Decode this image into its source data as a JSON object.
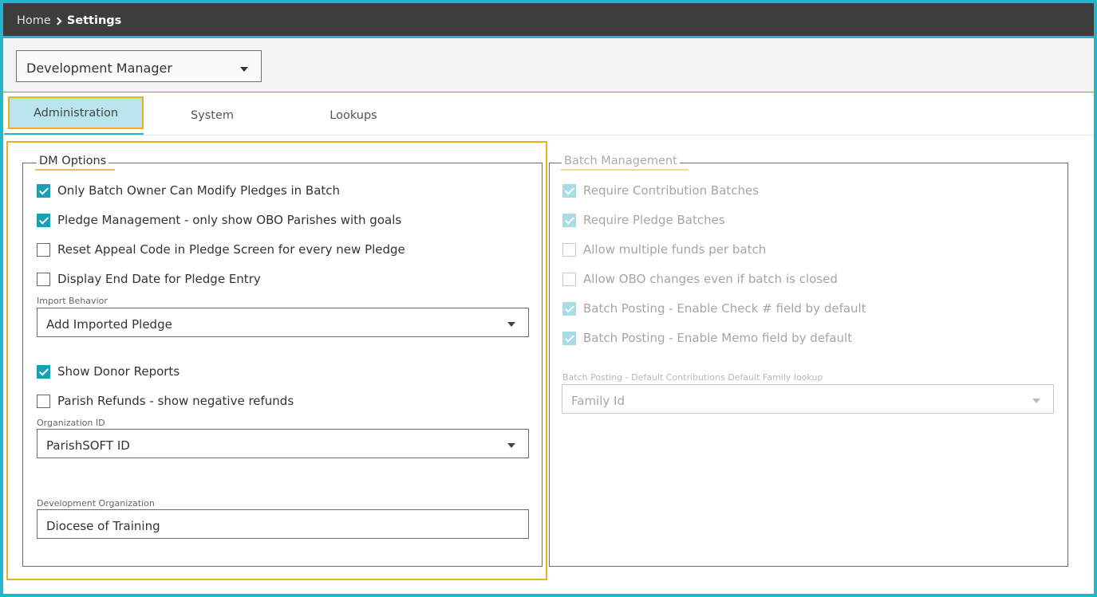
{
  "breadcrumb": {
    "home": "Home",
    "current": "Settings"
  },
  "module_select": {
    "value": "Development Manager"
  },
  "tabs": [
    {
      "label": "Administration",
      "active": true
    },
    {
      "label": "System",
      "active": false
    },
    {
      "label": "Lookups",
      "active": false
    }
  ],
  "dm_options": {
    "legend": "DM Options",
    "checks": [
      {
        "label": "Only Batch Owner Can Modify Pledges in Batch",
        "checked": true
      },
      {
        "label": "Pledge Management - only show OBO Parishes with goals",
        "checked": true
      },
      {
        "label": "Reset Appeal Code in Pledge Screen for every new Pledge",
        "checked": false
      },
      {
        "label": "Display End Date for Pledge Entry",
        "checked": false
      }
    ],
    "import_behavior": {
      "label": "Import Behavior",
      "value": "Add Imported Pledge"
    },
    "checks2": [
      {
        "label": "Show Donor Reports",
        "checked": true
      },
      {
        "label": "Parish Refunds - show negative refunds",
        "checked": false
      }
    ],
    "organization_id": {
      "label": "Organization ID",
      "value": "ParishSOFT ID"
    },
    "development_org": {
      "label": "Development Organization",
      "value": "Diocese of Training"
    }
  },
  "batch_management": {
    "legend": "Batch Management",
    "checks": [
      {
        "label": "Require Contribution Batches",
        "checked": true
      },
      {
        "label": "Require Pledge Batches",
        "checked": true
      },
      {
        "label": "Allow multiple funds per batch",
        "checked": false
      },
      {
        "label": "Allow OBO changes even if batch is closed",
        "checked": false
      },
      {
        "label": "Batch Posting - Enable Check # field by default",
        "checked": true
      },
      {
        "label": "Batch Posting - Enable Memo field by default",
        "checked": true
      }
    ],
    "family_lookup": {
      "label": "Batch Posting - Default Contributions Default Family lookup",
      "value": "Family Id"
    }
  },
  "colors": {
    "accent": "#1fb7c9",
    "highlight": "#f0ad1e",
    "topbar": "#3d3d3d",
    "checkbox": "#1a9fb3"
  }
}
